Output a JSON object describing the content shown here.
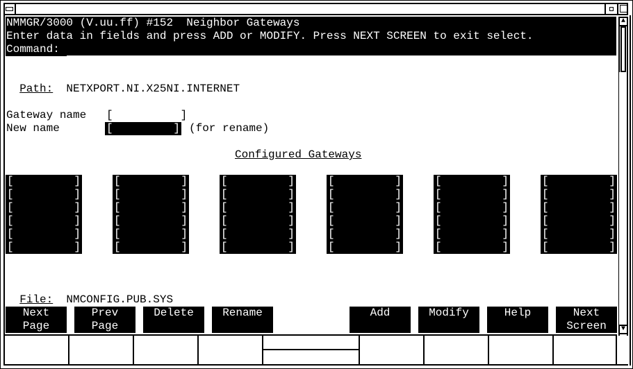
{
  "window": {
    "system_menu_icon": "window-menu-icon",
    "minimize_icon": "minimize-icon",
    "maximize_icon": "maximize-icon"
  },
  "header": {
    "title": "NMMGR/3000 (V.uu.ff) #152  Neighbor Gateways",
    "instructions": "Enter data in fields and press ADD or MODIFY. Press NEXT SCREEN to exit select.",
    "command_label": "Command:",
    "command_value": ""
  },
  "path": {
    "label": "Path:",
    "value": "NETXPORT.NI.X25NI.INTERNET"
  },
  "form": {
    "gateway_name_label": "Gateway name",
    "gateway_name_value": "",
    "new_name_label": "New name",
    "new_name_value": "",
    "new_name_hint": "(for rename)"
  },
  "configured": {
    "title": "Configured Gateways",
    "columns": [
      [
        "",
        "",
        "",
        "",
        "",
        ""
      ],
      [
        "",
        "",
        "",
        "",
        "",
        ""
      ],
      [
        "",
        "",
        "",
        "",
        "",
        ""
      ],
      [
        "",
        "",
        "",
        "",
        "",
        ""
      ],
      [
        "",
        "",
        "",
        "",
        "",
        ""
      ],
      [
        "",
        "",
        "",
        "",
        "",
        ""
      ]
    ]
  },
  "file": {
    "label": "File:",
    "value": "NMCONFIG.PUB.SYS"
  },
  "function_keys": [
    {
      "line1": "Next",
      "line2": "Page"
    },
    {
      "line1": "Prev",
      "line2": "Page"
    },
    {
      "line1": "Delete",
      "line2": ""
    },
    {
      "line1": "Rename",
      "line2": ""
    },
    {
      "line1": "Add",
      "line2": ""
    },
    {
      "line1": "Modify",
      "line2": ""
    },
    {
      "line1": "Help",
      "line2": ""
    },
    {
      "line1": "Next",
      "line2": "Screen"
    }
  ],
  "scrollbar": {
    "up_glyph": "▲",
    "down_glyph": "▼"
  }
}
